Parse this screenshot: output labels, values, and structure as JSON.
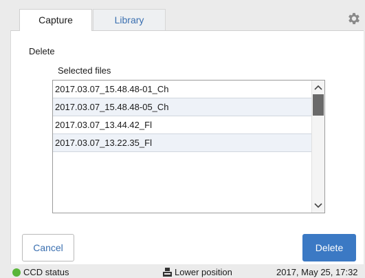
{
  "tabs": [
    {
      "label": "Capture"
    },
    {
      "label": "Library"
    }
  ],
  "dialog": {
    "title": "Delete",
    "selected_label": "Selected files",
    "files": [
      "2017.03.07_15.48.48-01_Ch",
      "2017.03.07_15.48.48-05_Ch",
      "2017.03.07_13.44.42_Fl",
      "2017.03.07_13.22.35_Fl"
    ],
    "cancel_label": "Cancel",
    "delete_label": "Delete"
  },
  "status": {
    "ccd_label": "CCD status",
    "ccd_color": "#5ab53a",
    "position_label": "Lower position",
    "datetime": "2017, May 25, 17:32"
  },
  "colors": {
    "accent": "#3b79c4",
    "link": "#3a6fb0"
  }
}
